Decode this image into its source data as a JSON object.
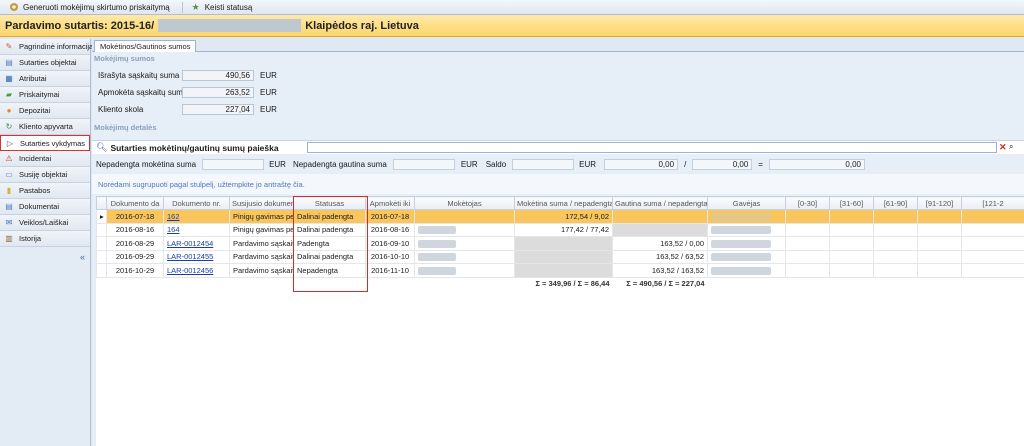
{
  "toolbar": {
    "btn1": {
      "label": "Generuoti mokėjimų skirtumo priskaitymą",
      "icon": "generate-icon"
    },
    "btn2": {
      "label": "Keisti statusą",
      "icon": "star-icon"
    }
  },
  "title": {
    "prefix": "Pardavimo sutartis: 2015-16/",
    "suffix": "Klaipėdos raj. Lietuva"
  },
  "sidebar": {
    "items": [
      {
        "label": "Pagrindinė informacija",
        "icon": "pencil-doc-icon"
      },
      {
        "label": "Sutarties objektai",
        "icon": "document-icon"
      },
      {
        "label": "Atributai",
        "icon": "attribute-icon"
      },
      {
        "label": "Priskaitymai",
        "icon": "accruals-icon"
      },
      {
        "label": "Depozitai",
        "icon": "deposit-icon"
      },
      {
        "label": "Kliento apyvarta",
        "icon": "turnover-icon"
      },
      {
        "label": "Sutarties vykdymas",
        "icon": "execution-icon"
      },
      {
        "label": "Incidentai",
        "icon": "incident-icon"
      },
      {
        "label": "Susiję objektai",
        "icon": "related-icon"
      },
      {
        "label": "Pastabos",
        "icon": "notes-icon"
      },
      {
        "label": "Dokumentai",
        "icon": "documents-icon"
      },
      {
        "label": "Veiklos/Laiškai",
        "icon": "mail-icon"
      },
      {
        "label": "Istorija",
        "icon": "history-icon"
      }
    ],
    "collapse": "«"
  },
  "tab": {
    "label": "Mokėtinos/Gautinos sumos"
  },
  "sums": {
    "header": "Mokėjimų sumos",
    "rows": [
      {
        "label": "Išrašyta sąskaitų suma",
        "value": "490,56",
        "unit": "EUR"
      },
      {
        "label": "Apmokėta sąskaitų suma",
        "value": "263,52",
        "unit": "EUR"
      },
      {
        "label": "Kliento skola",
        "value": "227,04",
        "unit": "EUR"
      }
    ]
  },
  "details": {
    "header": "Mokėjimų detalės"
  },
  "search_panel": {
    "title": "Sutarties mokėtinų/gautinų sumų paieška",
    "search_value": ""
  },
  "filters": {
    "unpaid_payable_label": "Nepadengta mokėtina suma",
    "unpaid_payable_unit": "EUR",
    "unpaid_receivable_label": "Nepadengta gautina suma",
    "unpaid_receivable_unit": "EUR",
    "saldo_label": "Saldo",
    "saldo_unit": "EUR",
    "v1": "0,00",
    "slash": "/",
    "v2": "0,00",
    "eq": "=",
    "v3": "0,00"
  },
  "group_hint": "Norėdami sugrupuoti pagal stulpelį, užtempkite jo antraštę čia.",
  "table": {
    "columns": [
      "Dokumento da",
      "Dokumento nr.",
      "Susijusio dokument",
      "Statusas",
      "Apmokėti iki",
      "Mokėtojas",
      "Mokėtina suma / nepadengta",
      "Gautina suma / nepadengta",
      "Gavėjas",
      "[0-30]",
      "[31-60]",
      "[61-90]",
      "[91-120]",
      "[121-2"
    ],
    "rows": [
      {
        "date": "2016-07-18",
        "doc": "162",
        "related": "Pinigų gavimas pe",
        "status": "Dalinai padengta",
        "due": "2016-07-18",
        "payable": "172,54 / 9,02",
        "receivable": "",
        "selected": true
      },
      {
        "date": "2016-08-16",
        "doc": "164",
        "related": "Pinigų gavimas pe",
        "status": "Dalinai padengta",
        "due": "2016-08-16",
        "payable": "177,42 / 77,42",
        "receivable": "",
        "selected": false
      },
      {
        "date": "2016-08-29",
        "doc": "LAR-0012454",
        "related": "Pardavimo sąskaita",
        "status": "Padengta",
        "due": "2016-09-10",
        "payable": "",
        "receivable": "163,52 / 0,00",
        "selected": false
      },
      {
        "date": "2016-09-29",
        "doc": "LAR-0012455",
        "related": "Pardavimo sąskaita",
        "status": "Dalinai padengta",
        "due": "2016-10-10",
        "payable": "",
        "receivable": "163,52 / 63,52",
        "selected": false
      },
      {
        "date": "2016-10-29",
        "doc": "LAR-0012456",
        "related": "Pardavimo sąskaita",
        "status": "Nepadengta",
        "due": "2016-11-10",
        "payable": "",
        "receivable": "163,52 / 163,52",
        "selected": false
      }
    ],
    "totals": {
      "payable": "Σ = 349,96 / Σ = 86,44",
      "receivable": "Σ = 490,56 / Σ = 227,04"
    }
  },
  "colors": {
    "title_bg": "#fcd66a",
    "selected_row": "#f9c65d",
    "highlight_border": "#d62a2a",
    "link": "#1a3ea8"
  }
}
